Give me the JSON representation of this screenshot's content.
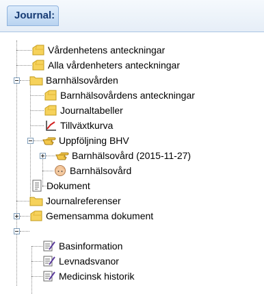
{
  "tab": {
    "label": "Journal:"
  },
  "tree": [
    {
      "label": "Vårdenhetens anteckningar",
      "icon": "notes-folder-icon"
    },
    {
      "label": "Alla vårdenheters anteckningar",
      "icon": "notes-folder-icon"
    },
    {
      "label": "Barnhälsovården",
      "icon": "folder-icon",
      "expander": "minus"
    },
    {
      "label": "Barnhälsovårdens anteckningar",
      "icon": "notes-folder-icon"
    },
    {
      "label": "Journaltabeller",
      "icon": "notes-folder-icon"
    },
    {
      "label": "Tillväxtkurva",
      "icon": "growth-chart-icon"
    },
    {
      "label": "Uppföljning BHV",
      "icon": "pointing-hand-icon",
      "expander": "minus"
    },
    {
      "label": "Barnhälsovård (2015-11-27)",
      "icon": "pointing-hand-icon",
      "expander": "plus"
    },
    {
      "label": "Barnhälsovård",
      "icon": "child-face-icon"
    },
    {
      "label": "Dokument",
      "icon": "document-icon"
    },
    {
      "label": "Journalreferenser",
      "icon": "folder-icon",
      "expander": "plus"
    },
    {
      "label": "Gemensamma dokument",
      "icon": "notes-folder-icon",
      "expander": "minus"
    },
    {
      "label": "Basinformation",
      "icon": "form-edit-icon"
    },
    {
      "label": "Levnadsvanor",
      "icon": "form-edit-icon"
    },
    {
      "label": "Medicinsk historik",
      "icon": "form-edit-icon"
    }
  ]
}
